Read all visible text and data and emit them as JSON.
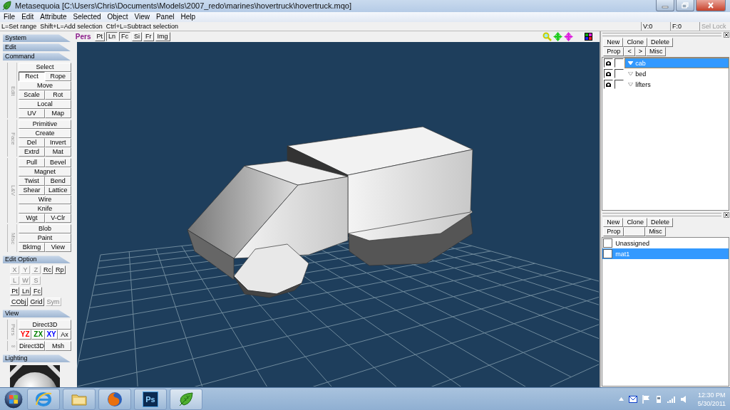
{
  "window": {
    "title": "Metasequoia [C:\\Users\\Chris\\Documents\\Models\\2007_redo\\marines\\hovertruck\\hovertruck.mqo]"
  },
  "menu": [
    "File",
    "Edit",
    "Attribute",
    "Selected",
    "Object",
    "View",
    "Panel",
    "Help"
  ],
  "hint": "L=Set range  Shift+L=Add selection  Ctrl+L=Subtract selection",
  "counters": [
    {
      "text": "V:0",
      "disabled": false
    },
    {
      "text": "F:0",
      "disabled": false
    },
    {
      "text": "Sel Lock",
      "disabled": true
    }
  ],
  "left_panel": {
    "collapsed_sections": [
      "System",
      "Edit"
    ],
    "command": {
      "title": "Command",
      "groups": [
        {
          "label": "Edit",
          "rows": [
            [
              {
                "label": "Select",
                "selected": false
              }
            ],
            [
              {
                "label": "Rect",
                "selected": true
              },
              {
                "label": "Rope",
                "selected": false
              }
            ],
            [
              {
                "label": "Move",
                "selected": false
              }
            ],
            [
              {
                "label": "Scale",
                "selected": false
              },
              {
                "label": "Rot",
                "selected": false
              }
            ],
            [
              {
                "label": "Local",
                "selected": false
              }
            ],
            [
              {
                "label": "UV",
                "selected": false
              },
              {
                "label": "Map",
                "selected": false
              }
            ]
          ]
        },
        {
          "label": "Face",
          "rows": [
            [
              {
                "label": "Primitive",
                "selected": false
              }
            ],
            [
              {
                "label": "Create",
                "selected": false
              }
            ],
            [
              {
                "label": "Del",
                "selected": false
              },
              {
                "label": "Invert",
                "selected": false
              }
            ],
            [
              {
                "label": "Extrd",
                "selected": false
              },
              {
                "label": "Mat",
                "selected": false
              }
            ]
          ]
        },
        {
          "label": "L&V",
          "rows": [
            [
              {
                "label": "Pull",
                "selected": false
              },
              {
                "label": "Bevel",
                "selected": false
              }
            ],
            [
              {
                "label": "Magnet",
                "selected": false
              }
            ],
            [
              {
                "label": "Twist",
                "selected": false
              },
              {
                "label": "Bend",
                "selected": false
              }
            ],
            [
              {
                "label": "Shear",
                "selected": false
              },
              {
                "label": "Lattice",
                "selected": false
              }
            ],
            [
              {
                "label": "Wire",
                "selected": false
              }
            ],
            [
              {
                "label": "Knife",
                "selected": false
              }
            ],
            [
              {
                "label": "Wgt",
                "selected": false
              },
              {
                "label": "V-Clr",
                "selected": false
              }
            ]
          ]
        },
        {
          "label": "Misc",
          "rows": [
            [
              {
                "label": "Blob",
                "selected": false
              }
            ],
            [
              {
                "label": "Paint",
                "selected": false
              }
            ],
            [
              {
                "label": "BkImg",
                "selected": false
              },
              {
                "label": "View",
                "selected": false
              }
            ]
          ]
        }
      ]
    },
    "edit_option": {
      "title": "Edit Option",
      "rows": [
        {
          "buttons": [
            {
              "label": "X",
              "disabled": true
            },
            {
              "label": "Y",
              "disabled": true
            },
            {
              "label": "Z",
              "disabled": true
            },
            {
              "label": "Rc",
              "disabled": false
            },
            {
              "label": "Rp",
              "disabled": false
            }
          ]
        },
        {
          "buttons": [
            {
              "label": "L",
              "disabled": true
            },
            {
              "label": "W",
              "disabled": true
            },
            {
              "label": "S",
              "disabled": true
            }
          ]
        },
        {
          "buttons": [
            {
              "label": "Pt",
              "disabled": false
            },
            {
              "label": "Ln",
              "disabled": false
            },
            {
              "label": "Fc",
              "disabled": false
            }
          ]
        },
        {
          "buttons": [
            {
              "label": "CObj",
              "disabled": false
            },
            {
              "label": "Grid",
              "disabled": false
            },
            {
              "label": "Sym",
              "disabled": true
            }
          ]
        }
      ]
    },
    "view": {
      "title": "View",
      "groups": [
        {
          "label": "Pers",
          "rows": [
            {
              "buttons": [
                {
                  "label": "Direct3D"
                }
              ]
            },
            {
              "buttons": [
                {
                  "label": "YZ",
                  "color": "#ff0000"
                },
                {
                  "label": "ZX",
                  "color": "#008000"
                },
                {
                  "label": "XY",
                  "color": "#0000ff"
                },
                {
                  "label": "Ax"
                }
              ]
            }
          ]
        },
        {
          "label": "∞",
          "rows": [
            {
              "buttons": [
                {
                  "label": "Direct3D"
                },
                {
                  "label": "Msh"
                }
              ]
            }
          ]
        }
      ]
    },
    "lighting": {
      "title": "Lighting"
    }
  },
  "viewport": {
    "mode": "Pers",
    "buttons": [
      {
        "label": "Pt",
        "selected": false
      },
      {
        "label": "Ln",
        "selected": true
      },
      {
        "label": "Fc",
        "selected": true
      },
      {
        "label": "Si",
        "selected": false
      },
      {
        "label": "Fr",
        "selected": false
      },
      {
        "label": "Img",
        "selected": false
      }
    ]
  },
  "objects": {
    "buttons": [
      [
        {
          "kind": "button",
          "label": "New"
        },
        {
          "kind": "button",
          "label": "Clone"
        },
        {
          "kind": "button",
          "label": "Delete"
        }
      ],
      [
        {
          "kind": "button",
          "label": "Prop"
        },
        {
          "kind": "button",
          "label": "<"
        },
        {
          "kind": "button",
          "label": ">"
        },
        {
          "kind": "button",
          "label": "Misc"
        }
      ]
    ],
    "items": [
      {
        "name": "cab",
        "selected": true,
        "expanded": true,
        "visible": true,
        "locked": false
      },
      {
        "name": "bed",
        "selected": false,
        "expanded": false,
        "visible": true,
        "locked": false
      },
      {
        "name": "lifters",
        "selected": false,
        "expanded": false,
        "visible": true,
        "locked": false
      }
    ]
  },
  "materials": {
    "buttons": [
      [
        {
          "kind": "button",
          "label": "New"
        },
        {
          "kind": "button",
          "label": "Clone"
        },
        {
          "kind": "button",
          "label": "Delete"
        }
      ],
      [
        {
          "kind": "button",
          "label": "Prop"
        },
        {
          "kind": "blank"
        },
        {
          "kind": "button",
          "label": "Misc"
        }
      ]
    ],
    "items": [
      {
        "name": "Unassigned",
        "selected": false
      },
      {
        "name": "mat1",
        "selected": true
      }
    ]
  },
  "taskbar": {
    "apps": [
      {
        "kind": "ie"
      },
      {
        "kind": "folder"
      },
      {
        "kind": "firefox"
      },
      {
        "kind": "ps",
        "label": "Ps"
      },
      {
        "kind": "leaf"
      }
    ],
    "time": "12:30 PM",
    "date": "5/30/2011"
  }
}
